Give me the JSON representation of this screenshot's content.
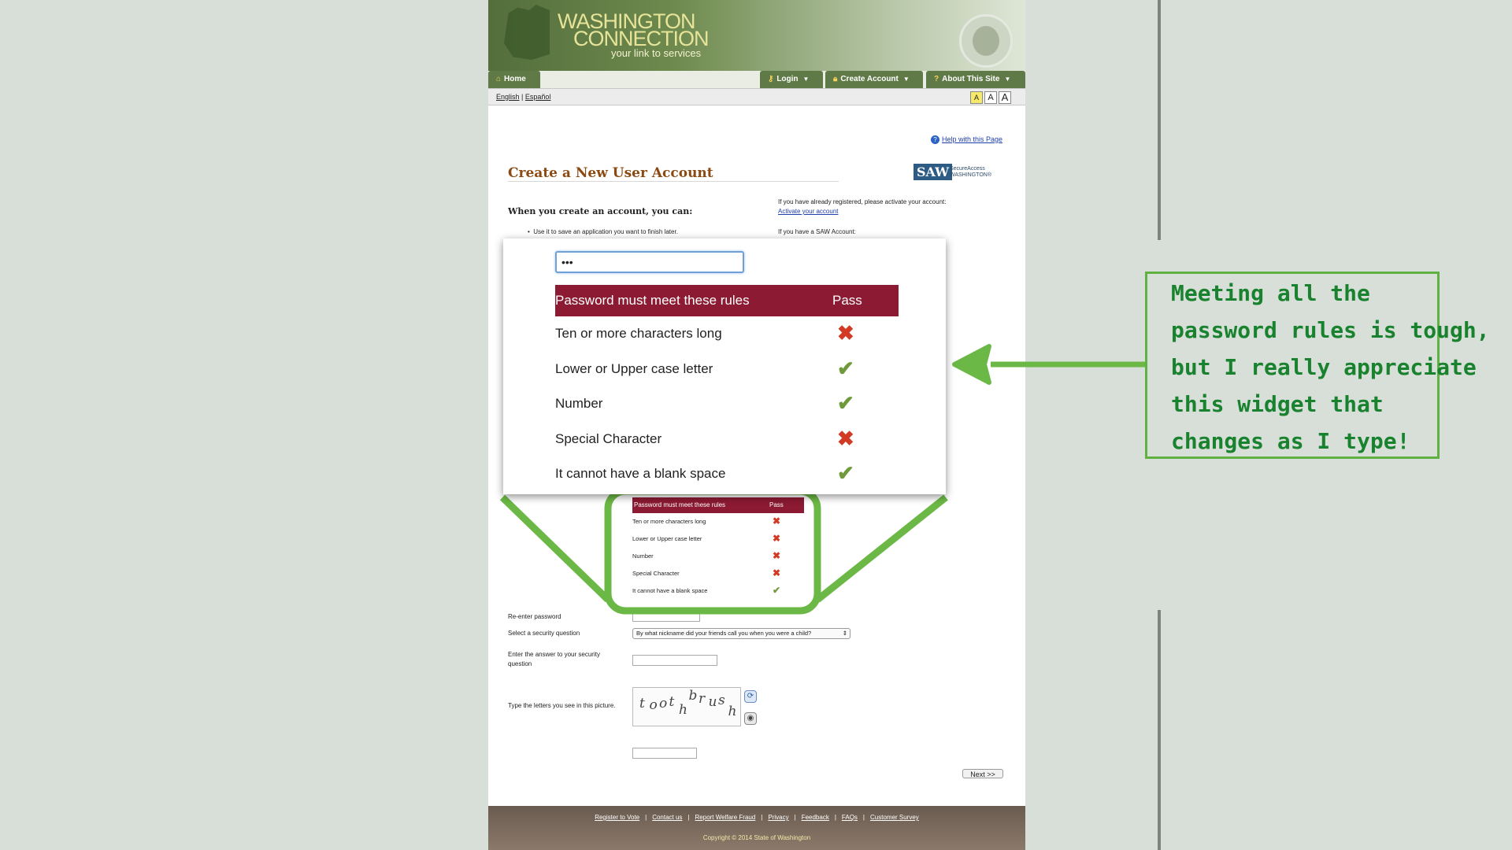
{
  "header": {
    "logo_line1": "WASHINGTON",
    "logo_line2": "CONNECTION",
    "logo_tagline": "your link to services"
  },
  "nav": {
    "home": "Home",
    "login": "Login",
    "create_account": "Create Account",
    "about": "About This Site"
  },
  "lang": {
    "english": "English",
    "sep": "|",
    "spanish": "Español",
    "sizes": [
      "A",
      "A",
      "A"
    ]
  },
  "help_link": "Help with this Page",
  "page_title": "Create a New User Account",
  "saw": {
    "logo": "SAW",
    "line1": "SecureAccess",
    "line2": "WASHINGTON®"
  },
  "create_heading": "When you create an account, you can:",
  "bullet1": "Use it to save an application you want to finish later.",
  "right_col": {
    "registered_text": "If you have already registered, please activate your account:",
    "activate_link": "Activate your account",
    "saw_text": "If you have a SAW Account:"
  },
  "rules": {
    "header_label": "Password must meet these rules",
    "header_pass": "Pass",
    "small": [
      {
        "label": "Ten or more characters long",
        "pass": false
      },
      {
        "label": "Lower or Upper case letter",
        "pass": false
      },
      {
        "label": "Number",
        "pass": false
      },
      {
        "label": "Special Character",
        "pass": false
      },
      {
        "label": "It cannot have a blank space",
        "pass": true
      }
    ],
    "zoomed": [
      {
        "label": "Ten or more characters long",
        "pass": false
      },
      {
        "label": "Lower or Upper case letter",
        "pass": true
      },
      {
        "label": "Number",
        "pass": true
      },
      {
        "label": "Special Character",
        "pass": false
      },
      {
        "label": "It cannot have a blank space",
        "pass": true
      }
    ]
  },
  "password_value": "•••",
  "form": {
    "reenter_label": "Re-enter password",
    "security_question_label": "Select a security question",
    "security_question_value": "By what nickname did your friends call you when you were a child?",
    "answer_label_1": "Enter the answer to your security",
    "answer_label_2": "question",
    "captcha_label": "Type the letters you see in this picture.",
    "captcha_text": [
      "t",
      "o",
      "o",
      "t",
      "h",
      "b",
      "r",
      "u",
      "s",
      "h"
    ],
    "next_button": "Next >>"
  },
  "footer": {
    "links": [
      "Register to Vote",
      "Contact us",
      "Report Welfare Fraud",
      "Privacy",
      "Feedback",
      "FAQs",
      "Customer Survey"
    ],
    "copyright": "Copyright © 2014 State of Washington"
  },
  "annotation": {
    "lines": [
      "Meeting all the",
      "password rules is tough,",
      "but I really appreciate",
      "this widget that",
      "changes as I type!"
    ]
  },
  "colors": {
    "rules_header": "#8b1a32",
    "fail": "#d23a25",
    "pass": "#6f9a3c",
    "annotation_green": "#19822e",
    "annotation_border": "#5fb142"
  }
}
